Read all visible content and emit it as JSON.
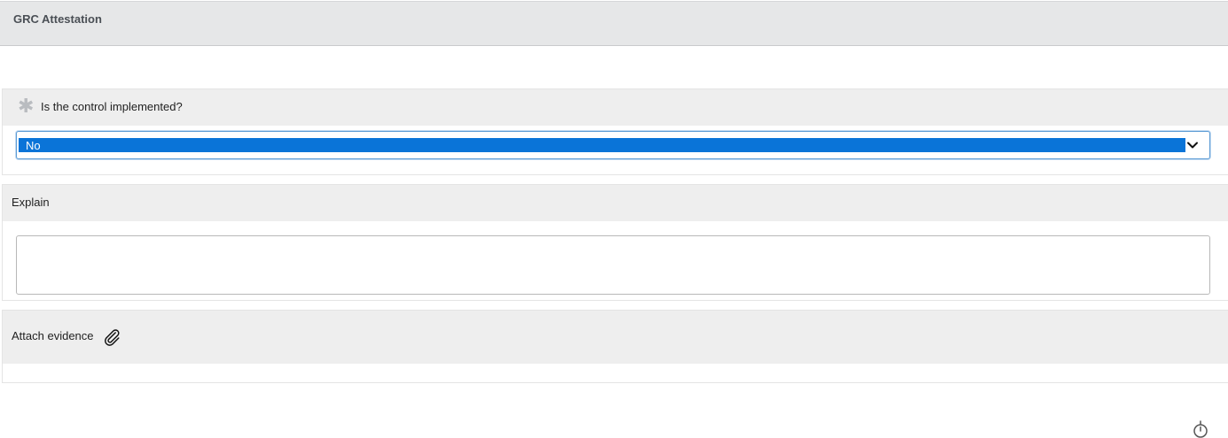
{
  "header": {
    "title": "GRC Attestation"
  },
  "questions": {
    "implemented": {
      "label": "Is the control implemented?",
      "mandatory_icon": "asterisk-icon",
      "selected_value": "No",
      "dropdown_icon": "chevron-down-icon"
    },
    "explain": {
      "label": "Explain",
      "value": ""
    },
    "attachment": {
      "label": "Attach evidence",
      "icon": "paperclip-icon"
    }
  },
  "footer": {
    "icon": "stopwatch-icon"
  },
  "colors": {
    "header_bg": "#e6e7e8",
    "section_bg": "#eeeeee",
    "selection_blue": "#0a74d8",
    "focus_border": "#5b9bd5"
  }
}
